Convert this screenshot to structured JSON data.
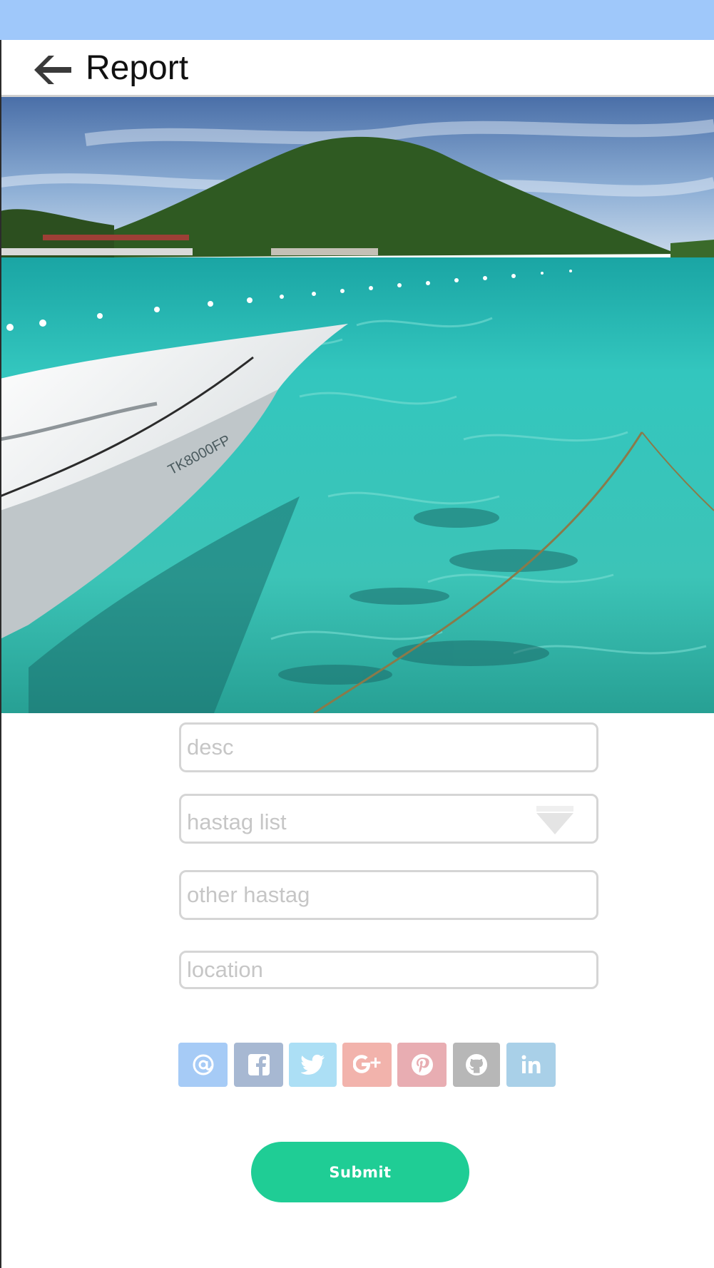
{
  "header": {
    "back_icon": "arrow-left-icon",
    "title": "Report"
  },
  "hero": {
    "description_icon": "photo"
  },
  "form": {
    "desc_placeholder": "desc",
    "hashtag_select": {
      "label": "hastag list",
      "icon": "chevron-down-icon"
    },
    "other_hashtag_placeholder": "other hastag",
    "location_placeholder": "location"
  },
  "social": [
    {
      "name": "email",
      "icon": "at-icon",
      "color": "#a6cbf6"
    },
    {
      "name": "facebook",
      "icon": "facebook-icon",
      "color": "#a7b8d2"
    },
    {
      "name": "twitter",
      "icon": "twitter-icon",
      "color": "#acdff5"
    },
    {
      "name": "google-plus",
      "icon": "google-plus-icon",
      "color": "#f2b3ac"
    },
    {
      "name": "pinterest",
      "icon": "pinterest-icon",
      "color": "#e8adb2"
    },
    {
      "name": "github",
      "icon": "github-icon",
      "color": "#b7b7b7"
    },
    {
      "name": "linkedin",
      "icon": "linkedin-icon",
      "color": "#a9d0e8"
    }
  ],
  "actions": {
    "submit_label": "Submit"
  },
  "colors": {
    "status_bar": "#9fc8fa",
    "accent": "#1fcd95"
  }
}
